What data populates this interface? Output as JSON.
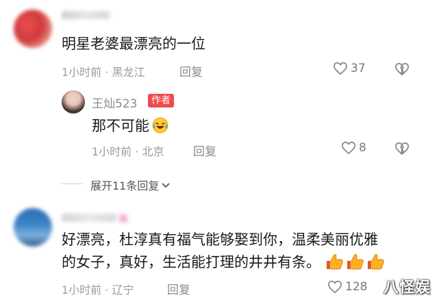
{
  "comments": [
    {
      "text": "明星老婆最漂亮的一位",
      "time": "1小时前",
      "location": "黑龙江",
      "reply_label": "回复",
      "likes": "37"
    }
  ],
  "reply": {
    "username": "王灿523",
    "author_badge": "作者",
    "text": "那不可能",
    "time": "1小时前",
    "location": "北京",
    "reply_label": "回复",
    "likes": "8"
  },
  "expand": {
    "label": "展开11条回复"
  },
  "comment2": {
    "line1": "好漂亮，杜淳真有福气能够娶到你，温柔美丽优雅",
    "line2": "的女子，真好，生活能打理的井井有条。",
    "time": "1小时前",
    "location": "辽宁",
    "reply_label": "回复",
    "likes": "128"
  },
  "watermark": "八怪娱",
  "colors": {
    "badge_bg": "#f04a4a",
    "meta_gray": "#9a9a9a",
    "text_dark": "#1a1a1a"
  },
  "icons": [
    "heart-outline-icon",
    "broken-heart-icon",
    "chevron-down-icon",
    "laughing-emoji",
    "thumbs-up-emoji"
  ]
}
